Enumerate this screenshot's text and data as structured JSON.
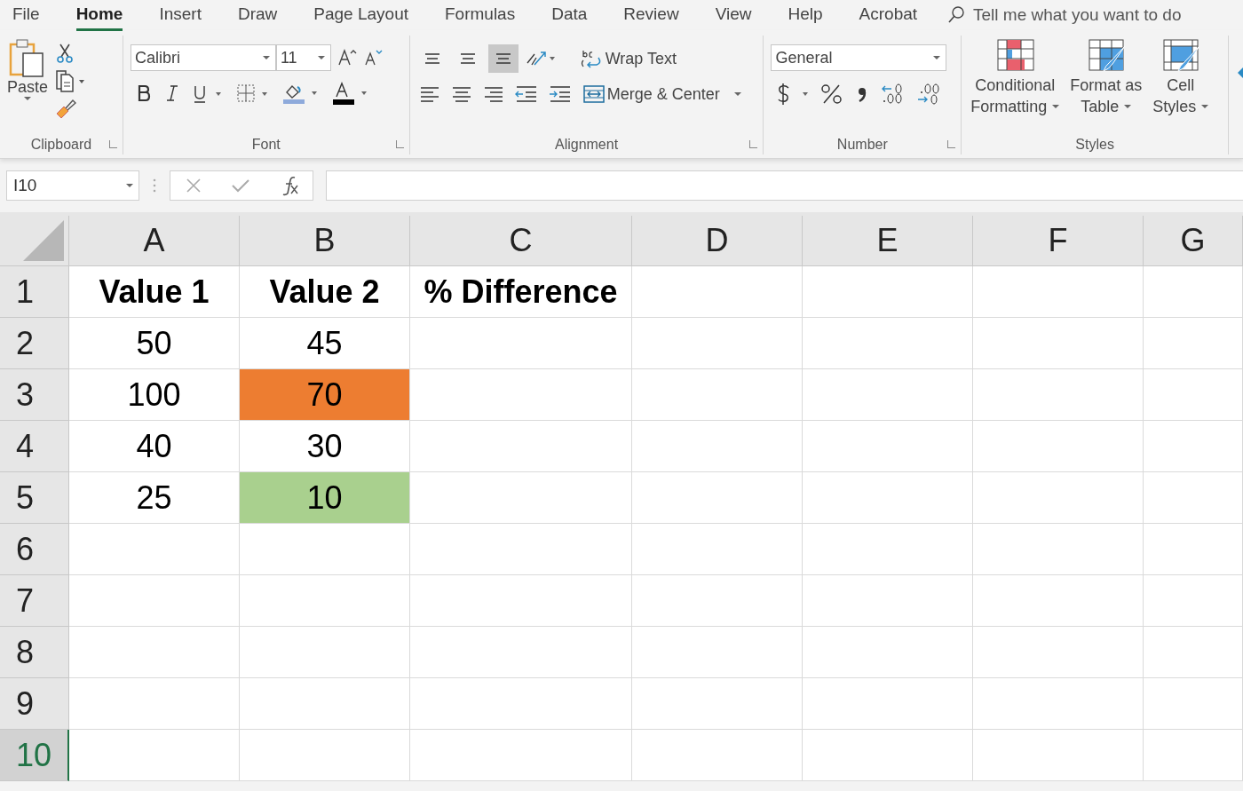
{
  "menu_tabs": [
    {
      "label": "File",
      "selected": false
    },
    {
      "label": "Home",
      "selected": true
    },
    {
      "label": "Insert",
      "selected": false
    },
    {
      "label": "Draw",
      "selected": false
    },
    {
      "label": "Page Layout",
      "selected": false
    },
    {
      "label": "Formulas",
      "selected": false
    },
    {
      "label": "Data",
      "selected": false
    },
    {
      "label": "Review",
      "selected": false
    },
    {
      "label": "View",
      "selected": false
    },
    {
      "label": "Help",
      "selected": false
    },
    {
      "label": "Acrobat",
      "selected": false
    }
  ],
  "tell_me": {
    "placeholder": "Tell me what you want to do"
  },
  "ribbon": {
    "clipboard": {
      "label": "Clipboard",
      "paste": "Paste"
    },
    "font": {
      "label": "Font",
      "font_name": "Calibri",
      "font_size": "11"
    },
    "alignment": {
      "label": "Alignment",
      "vertical_buttons": [
        {
          "selected": false
        },
        {
          "selected": false
        },
        {
          "selected": true
        }
      ],
      "wrap_text": "Wrap Text",
      "merge_center": "Merge & Center"
    },
    "number": {
      "label": "Number",
      "format": "General"
    },
    "styles": {
      "label": "Styles",
      "buttons": [
        {
          "kind": "conditional",
          "line1": "Conditional",
          "line2": "Formatting"
        },
        {
          "kind": "table",
          "line1": "Format as",
          "line2": "Table"
        },
        {
          "kind": "cell",
          "line1": "Cell",
          "line2": "Styles"
        }
      ]
    }
  },
  "formula_bar": {
    "name_box": "I10"
  },
  "sheet": {
    "columns": [
      "A",
      "B",
      "C",
      "D",
      "E",
      "F",
      "G"
    ],
    "rows": [
      {
        "label": "1",
        "selected": false,
        "cells": [
          {
            "text": "Value 1",
            "bold": true
          },
          {
            "text": "Value 2",
            "bold": true
          },
          {
            "text": "% Difference",
            "bold": true
          }
        ]
      },
      {
        "label": "2",
        "selected": false,
        "cells": [
          {
            "text": "50",
            "bold": false
          },
          {
            "text": "45",
            "bold": false
          }
        ]
      },
      {
        "label": "3",
        "selected": false,
        "cells": [
          {
            "text": "100",
            "bold": false
          },
          {
            "text": "70",
            "bold": false,
            "color": "#ed7d31"
          }
        ]
      },
      {
        "label": "4",
        "selected": false,
        "cells": [
          {
            "text": "40",
            "bold": false
          },
          {
            "text": "30",
            "bold": false
          }
        ]
      },
      {
        "label": "5",
        "selected": false,
        "cells": [
          {
            "text": "25",
            "bold": false
          },
          {
            "text": "10",
            "bold": false,
            "color": "#a9d08e"
          }
        ]
      },
      {
        "label": "6",
        "selected": false,
        "cells": []
      },
      {
        "label": "7",
        "selected": false,
        "cells": []
      },
      {
        "label": "8",
        "selected": false,
        "cells": []
      },
      {
        "label": "9",
        "selected": false,
        "cells": []
      },
      {
        "label": "10",
        "selected": true,
        "cells": []
      }
    ]
  }
}
